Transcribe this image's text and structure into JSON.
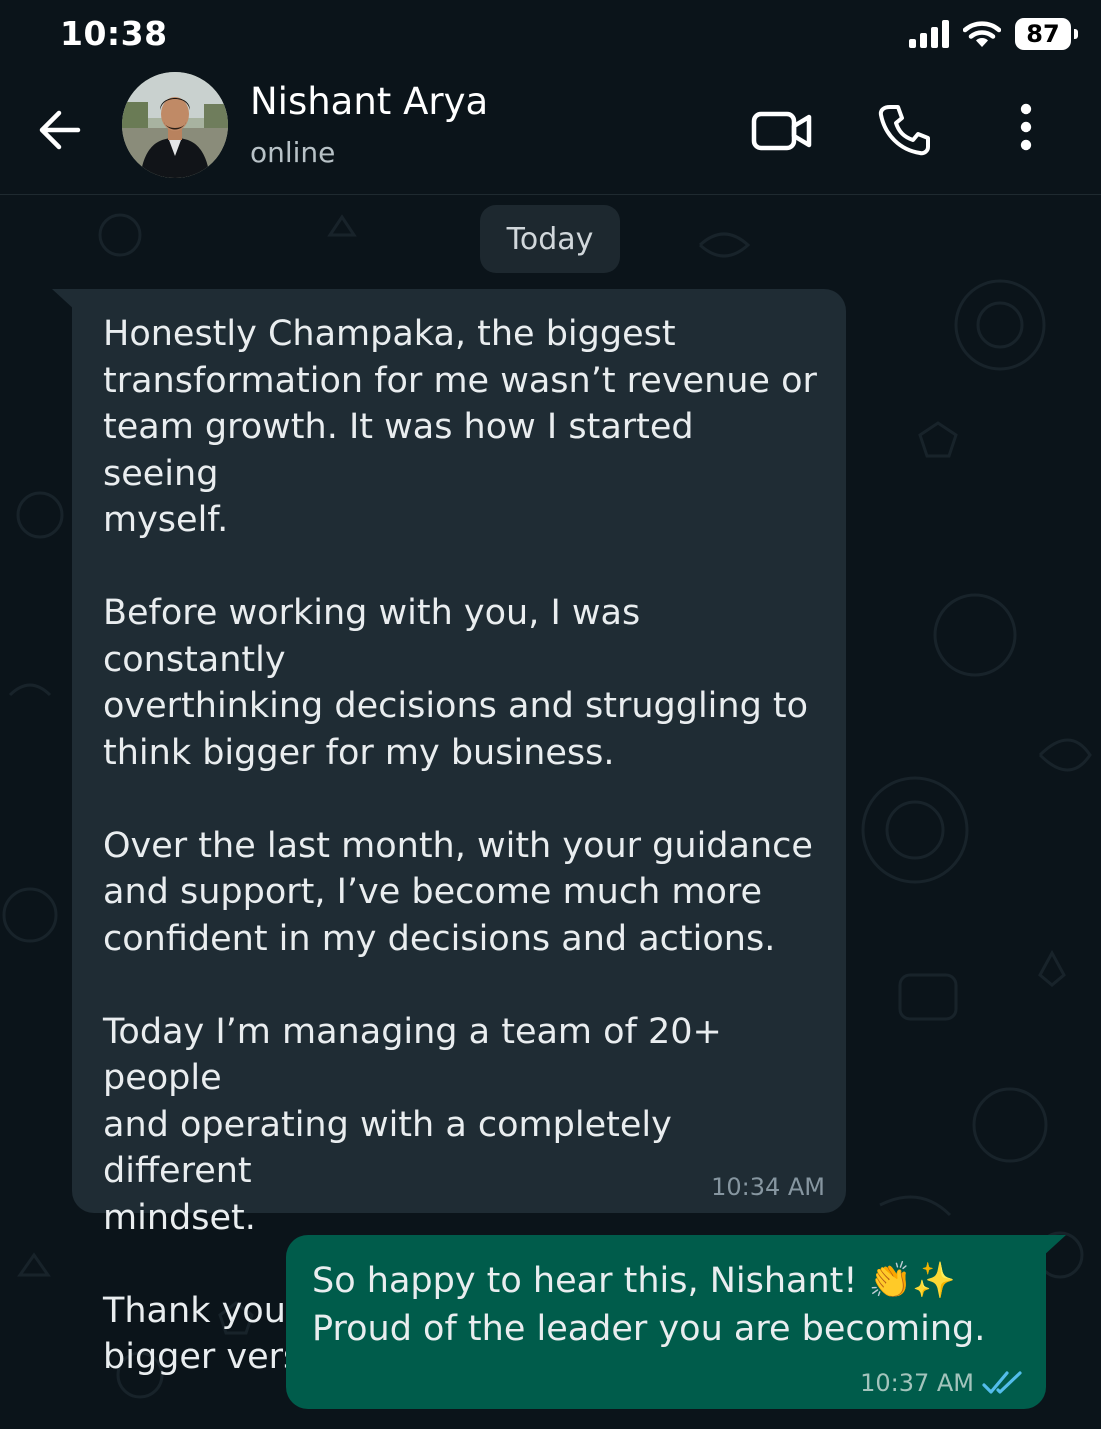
{
  "status_bar": {
    "time": "10:38",
    "battery": "87"
  },
  "header": {
    "contact_name": "Nishant Arya",
    "contact_status": "online",
    "icons": [
      "back-arrow-icon",
      "video-call-icon",
      "phone-icon",
      "more-vert-icon"
    ]
  },
  "chat": {
    "date_divider": "Today",
    "messages": [
      {
        "direction": "incoming",
        "text": "Honestly Champaka, the biggest\ntransformation for me wasn’t revenue or\nteam growth. It was how I started  seeing\nmyself.\n\nBefore working with you, I was constantly\noverthinking decisions and struggling to\nthink bigger for my business.\n\nOver the last month, with your guidance\nand support, I’ve become much more\nconfident in my decisions and actions.\n\nToday I’m managing a team of 20+ people\nand operating with a completely different\nmindset.\n\nThank you for helping me step into a\nbigger version of myself. 🙏",
        "time": "10:34 AM"
      },
      {
        "direction": "outgoing",
        "text": "So happy to hear this, Nishant! 👏✨\nProud of the leader you are becoming.",
        "time": "10:37 AM",
        "status": "read"
      }
    ]
  },
  "colors": {
    "background": "#0b141a",
    "incoming_bubble": "#1f2c34",
    "outgoing_bubble": "#005c4b",
    "read_ticks": "#53bdeb"
  }
}
